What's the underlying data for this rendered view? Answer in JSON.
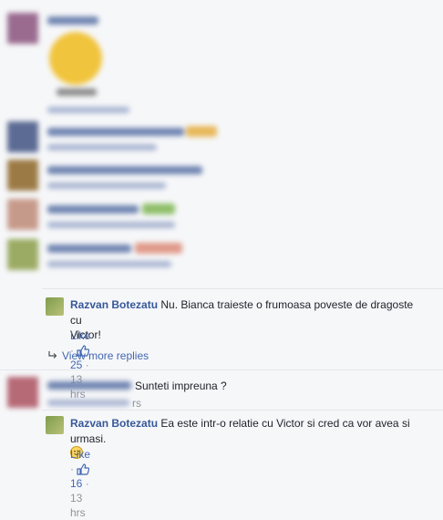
{
  "comments": [
    {
      "author": "Razvan Botezatu",
      "text_line1": "Nu. Bianca traieste o frumoasa poveste de dragoste",
      "text_line2": "cu Victor!",
      "like_label": "Like",
      "reactions": "25",
      "time": "13 hrs"
    },
    {
      "view_more_label": "View more replies"
    },
    {
      "text": "Sunteti impreuna ?",
      "time_partial": "rs"
    },
    {
      "author": "Razvan Botezatu",
      "text_line1": "Ea este intr-o relatie cu Victor si cred ca vor avea si",
      "text_line2": "urmasi.",
      "like_label": "Like",
      "reactions": "16",
      "time": "13 hrs"
    }
  ],
  "colors": {
    "link": "#365899",
    "like": "#4267b2",
    "meta": "#90949c",
    "background": "#f6f7f9"
  },
  "icons": [
    "thumbs-up-icon",
    "smile-emoji-icon",
    "reply-arrow-icon"
  ]
}
